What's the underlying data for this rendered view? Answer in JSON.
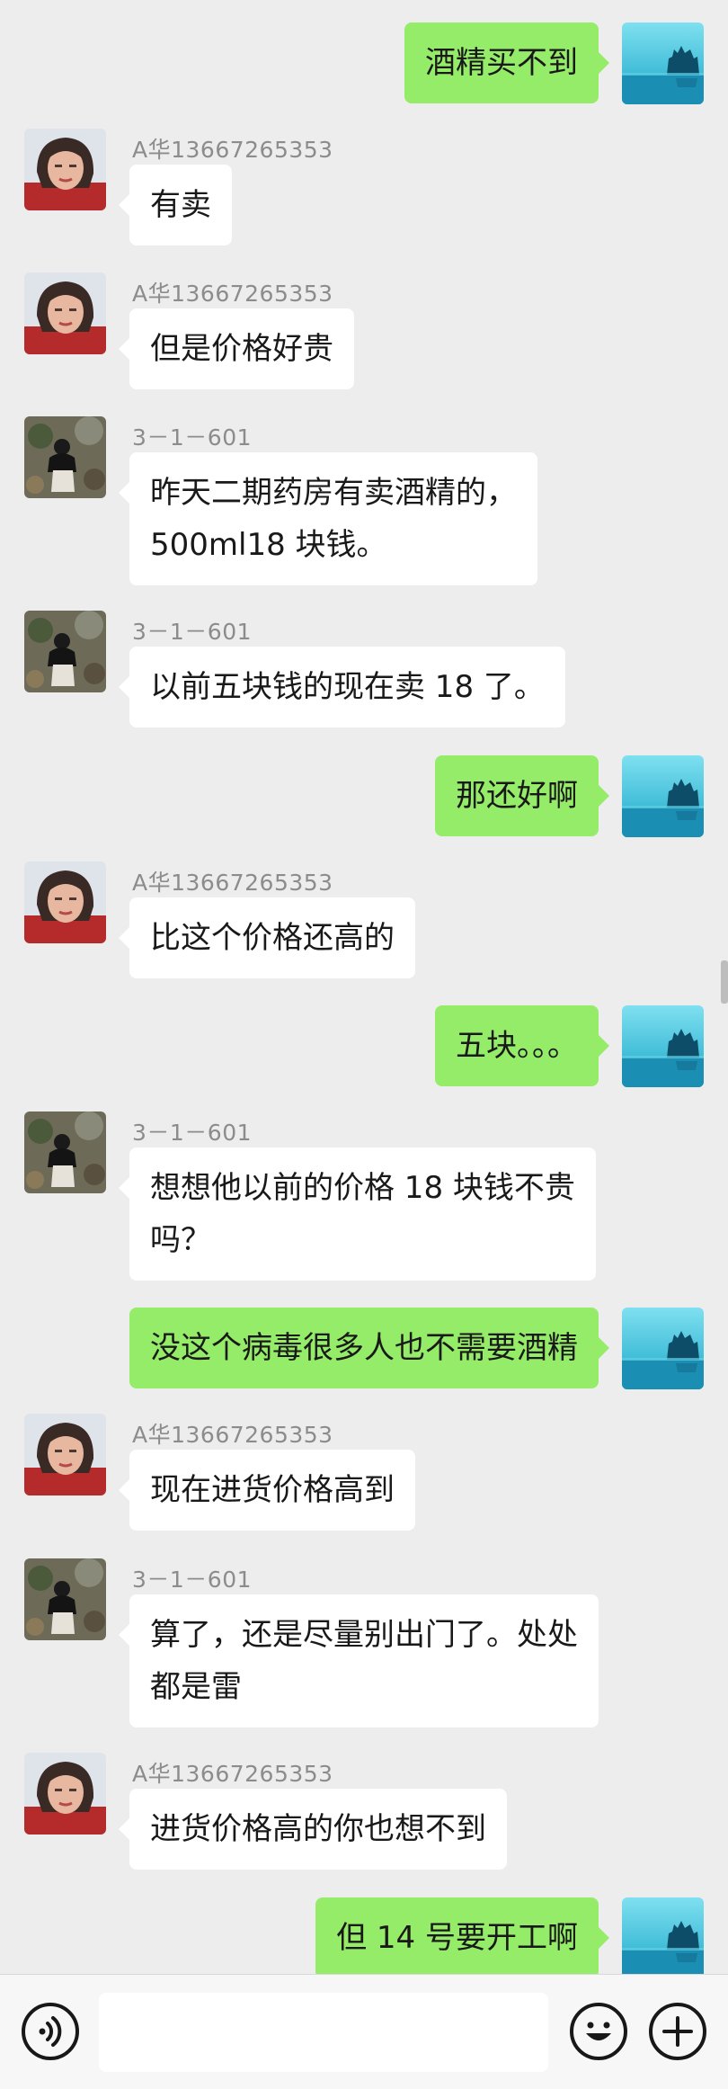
{
  "messages": [
    {
      "dir": "out",
      "lines": [
        "酒精买不到"
      ]
    },
    {
      "dir": "in",
      "sender": "A华13667265353",
      "avatar": "woman",
      "lines": [
        "有卖"
      ]
    },
    {
      "dir": "in",
      "sender": "A华13667265353",
      "avatar": "woman",
      "lines": [
        "但是价格好贵"
      ]
    },
    {
      "dir": "in",
      "sender": "3－1－601",
      "avatar": "child",
      "lines": [
        "昨天二期药房有卖酒精的，",
        "500ml18 块钱。"
      ]
    },
    {
      "dir": "in",
      "sender": "3－1－601",
      "avatar": "child",
      "lines": [
        "以前五块钱的现在卖 18 了。"
      ]
    },
    {
      "dir": "out",
      "lines": [
        "那还好啊"
      ]
    },
    {
      "dir": "in",
      "sender": "A华13667265353",
      "avatar": "woman",
      "lines": [
        "比这个价格还高的"
      ]
    },
    {
      "dir": "out",
      "lines": [
        "五块。。。"
      ]
    },
    {
      "dir": "in",
      "sender": "3－1－601",
      "avatar": "child",
      "lines": [
        "想想他以前的价格 18 块钱不贵",
        "吗？"
      ]
    },
    {
      "dir": "out",
      "lines": [
        "没这个病毒很多人也不需要酒精"
      ]
    },
    {
      "dir": "in",
      "sender": "A华13667265353",
      "avatar": "woman",
      "lines": [
        "现在进货价格高到"
      ]
    },
    {
      "dir": "in",
      "sender": "3－1－601",
      "avatar": "child",
      "lines": [
        "算了，还是尽量别出门了。处处",
        "都是雷"
      ]
    },
    {
      "dir": "in",
      "sender": "A华13667265353",
      "avatar": "woman",
      "lines": [
        "进货价格高的你也想不到"
      ]
    },
    {
      "dir": "out",
      "lines": [
        "但 14 号要开工啊"
      ]
    }
  ],
  "input_bar": {
    "voice_icon": "voice-icon",
    "emoji_icon": "emoji-icon",
    "plus_icon": "plus-icon",
    "input_value": ""
  },
  "colors": {
    "background": "#ededed",
    "outgoing_bubble": "#95ec69",
    "incoming_bubble": "#ffffff",
    "sender_name": "#8c8c8c"
  }
}
